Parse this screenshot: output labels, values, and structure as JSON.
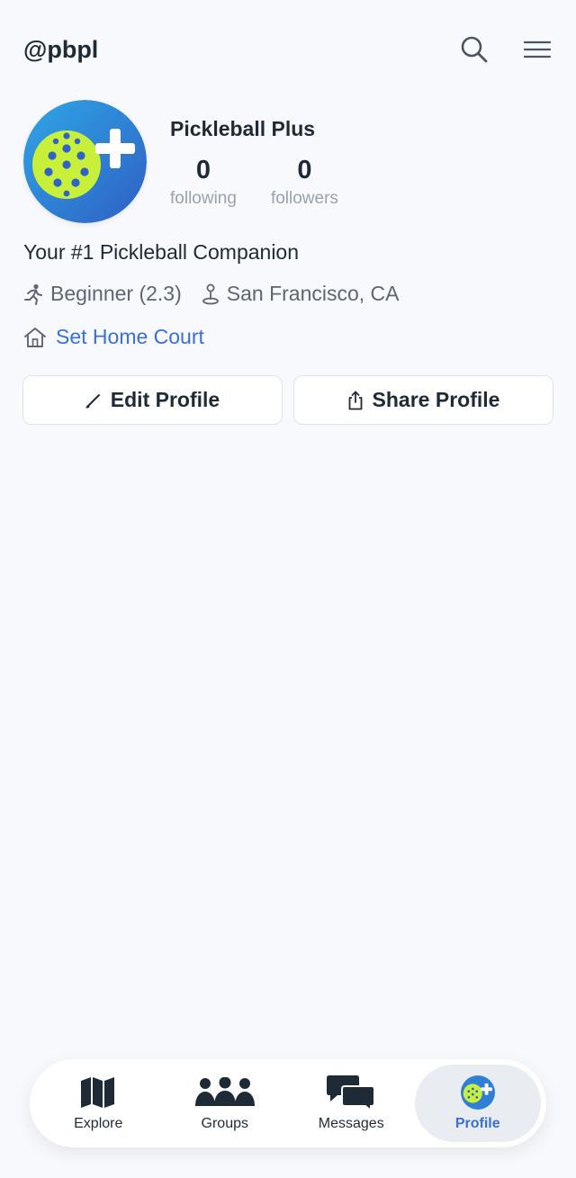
{
  "header": {
    "handle": "@pbpl"
  },
  "profile": {
    "display_name": "Pickleball Plus",
    "following_count": "0",
    "following_label": "following",
    "followers_count": "0",
    "followers_label": "followers",
    "bio": "Your #1 Pickleball Companion",
    "skill": "Beginner (2.3)",
    "location": "San Francisco, CA",
    "home_court_link": "Set Home Court"
  },
  "actions": {
    "edit_label": "Edit Profile",
    "share_label": "Share Profile"
  },
  "nav": {
    "items": [
      {
        "label": "Explore",
        "icon": "map-icon"
      },
      {
        "label": "Groups",
        "icon": "people-icon"
      },
      {
        "label": "Messages",
        "icon": "chat-icon"
      },
      {
        "label": "Profile",
        "icon": "avatar-icon",
        "active": true
      }
    ]
  },
  "colors": {
    "accent": "#3b6fd8",
    "ball": "#c8f03a",
    "background": "#f7f9fc"
  }
}
